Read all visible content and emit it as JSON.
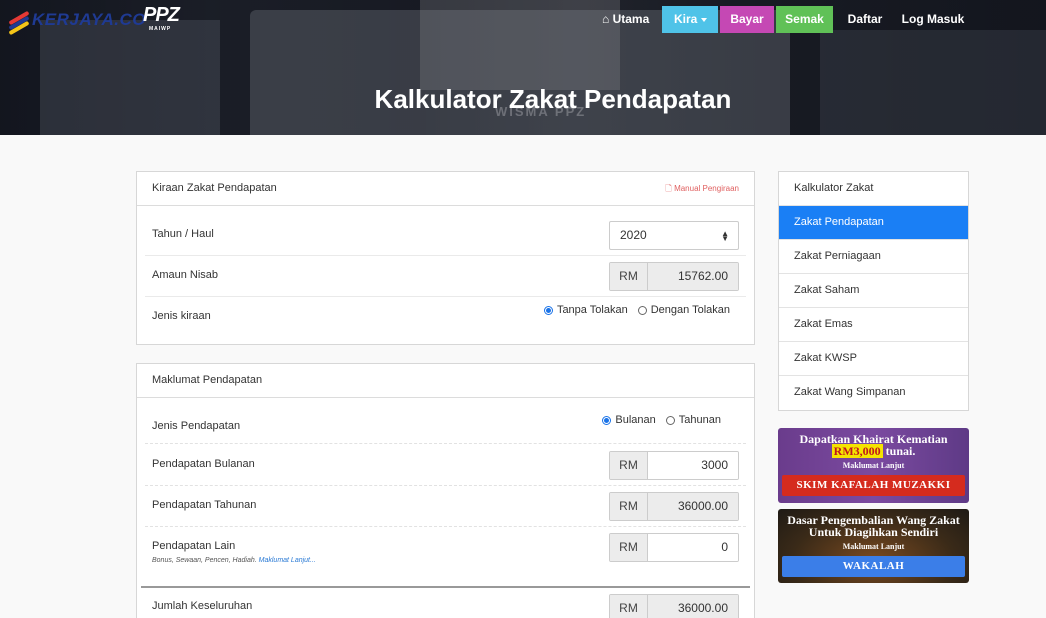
{
  "brand": {
    "logo_text": "KERJAYA.CO",
    "ppz": "PPZ",
    "ppz_sub": "MAIWP",
    "building_sign": "WISMA PPZ"
  },
  "nav": {
    "utama": "Utama",
    "kira": "Kira",
    "bayar": "Bayar",
    "semak": "Semak",
    "daftar": "Daftar",
    "log_masuk": "Log Masuk"
  },
  "page_title": "Kalkulator Zakat Pendapatan",
  "kiraan": {
    "header": "Kiraan Zakat Pendapatan",
    "manual": "Manual Pengiraan",
    "tahun_label": "Tahun / Haul",
    "tahun_value": "2020",
    "nisab_label": "Amaun Nisab",
    "currency": "RM",
    "nisab_value": "15762.00",
    "jenis_label": "Jenis kiraan",
    "opt_tanpa": "Tanpa Tolakan",
    "opt_dengan": "Dengan Tolakan"
  },
  "maklumat": {
    "header": "Maklumat Pendapatan",
    "jenis_label": "Jenis Pendapatan",
    "opt_bulanan": "Bulanan",
    "opt_tahunan": "Tahunan",
    "bulanan_label": "Pendapatan Bulanan",
    "bulanan_value": "3000",
    "tahunan_label": "Pendapatan Tahunan",
    "tahunan_value": "36000.00",
    "lain_label": "Pendapatan Lain",
    "lain_hint": "Bonus, Sewaan, Pencen, Hadiah.",
    "lain_link": "Maklumat Lanjut...",
    "lain_value": "0",
    "jumlah_label": "Jumlah Keseluruhan",
    "jumlah_value": "36000.00"
  },
  "sidebar": {
    "header": "Kalkulator Zakat",
    "items": [
      "Zakat Pendapatan",
      "Zakat Perniagaan",
      "Zakat Saham",
      "Zakat Emas",
      "Zakat KWSP",
      "Zakat Wang Simpanan"
    ]
  },
  "banner1": {
    "line1": "Dapatkan Khairat Kematian",
    "amount": "RM3,000",
    "line2": "tunai.",
    "sub": "Maklumat Lanjut",
    "button": "SKIM KAFALAH MUZAKKI"
  },
  "banner2": {
    "line1": "Dasar Pengembalian Wang Zakat",
    "line2": "Untuk Diagihkan Sendiri",
    "sub": "Maklumat Lanjut",
    "button": "WAKALAH"
  },
  "colors": {
    "kira": "#4fc3e8",
    "bayar": "#c548b4",
    "semak": "#60c157",
    "active": "#1a7ff5"
  }
}
